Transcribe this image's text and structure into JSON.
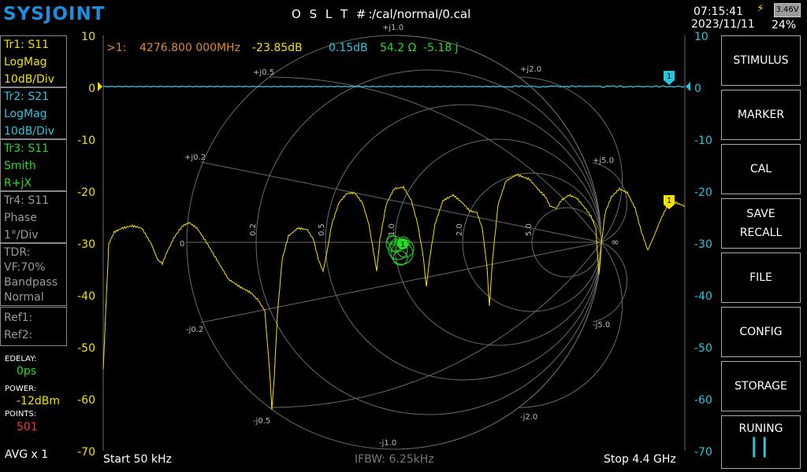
{
  "header": {
    "logo": "SYSJOINT",
    "cal_label": "O S L T #:",
    "cal_path": "/cal/normal/0.cal",
    "time": "07:15:41",
    "date": "2023/11/11",
    "battery_voltage": "3.46V",
    "battery_percent": "24%"
  },
  "traces": [
    {
      "lines": [
        "Tr1:   S11",
        "LogMag",
        "10dB/Div"
      ],
      "color": "#f5e000"
    },
    {
      "lines": [
        "Tr2:   S21",
        "LogMag",
        "10dB/Div"
      ],
      "color": "#26c6e0"
    },
    {
      "lines": [
        "Tr3:   S11",
        "Smith",
        "R+jX"
      ],
      "color": "#22dd22"
    },
    {
      "lines": [
        "Tr4:   S11",
        "Phase",
        "1°/Div"
      ],
      "color": "#9a9a9a"
    }
  ],
  "tdr": {
    "lines": [
      "TDR:",
      "VF:70%",
      "Bandpass",
      "Normal"
    ]
  },
  "refs": {
    "lines": [
      "Ref1:",
      "Ref2:"
    ]
  },
  "edelay": {
    "label": "EDELAY:",
    "value": "0ps"
  },
  "power": {
    "label": "POWER:",
    "value": "-12dBm"
  },
  "points": {
    "label": "POINTS:",
    "value": "501"
  },
  "avg": "AVG x 1",
  "marker_readout": {
    "prefix": ">1:",
    "freq": "4276.800 000MHz",
    "s11": "-23.85dB",
    "s21": "0.15dB",
    "r": "54.2 Ω",
    "x": "-5.18 j"
  },
  "y_axis_left": [
    "10",
    "0",
    "-10",
    "-20",
    "-30",
    "-40",
    "-50",
    "-60",
    "-70"
  ],
  "y_axis_right": [
    "10",
    "0",
    "-10",
    "-20",
    "-30",
    "-40",
    "-50",
    "-60",
    "-70"
  ],
  "smith_labels": {
    "top": "+j1.0",
    "bottom": "-j1.0",
    "p05": "+j0.5",
    "p02": "+j0.2",
    "p20": "+j2.0",
    "p50": "+j5.0",
    "m05": "-j0.5",
    "m02": "-j0.2",
    "m20": "-j2.0",
    "m50": "-j5.0",
    "r0": "0",
    "r02": "0.2",
    "r05": "0.5",
    "r10": "1.0",
    "r20": "2.0",
    "r50": "5.0",
    "rinf": "∞"
  },
  "markers": {
    "tr1": "1",
    "tr2": "1",
    "tr3": "1"
  },
  "footer": {
    "start": "Start    50 kHz",
    "ifbw": "IFBW: 6.25kHz",
    "stop": "Stop    4.4 GHz"
  },
  "softkeys": [
    "STIMULUS",
    "MARKER",
    "CAL",
    "SAVE\nRECALL",
    "FILE",
    "CONFIG",
    "STORAGE",
    "RUNING"
  ],
  "pause_symbol": "||",
  "colors": {
    "tr1": "#f5e000",
    "tr2": "#26c6e0",
    "tr3": "#22dd22",
    "tr4": "#9a9a9a",
    "marker_freq": "#e08a2a",
    "edelay": "#22dd22",
    "power": "#f5e000",
    "points": "#ff3030",
    "logo": "#1a8fe0"
  }
}
